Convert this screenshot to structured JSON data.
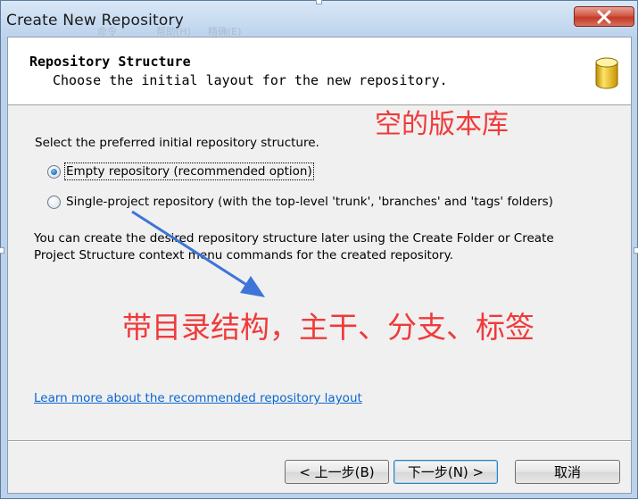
{
  "window": {
    "title": "Create New Repository",
    "background_text": [
      "命令",
      "帮助(H)",
      "精确(E)"
    ],
    "close_icon": "close-icon"
  },
  "header": {
    "title": "Repository Structure",
    "subtitle": "Choose the initial layout for the new repository.",
    "icon": "database-icon"
  },
  "annotations": {
    "empty_note": "空的版本库",
    "structure_note": "带目录结构，主干、分支、标签",
    "color": "#f03a3a"
  },
  "content": {
    "prompt": "Select the preferred initial repository structure.",
    "options": [
      {
        "label": "Empty repository (recommended option)",
        "selected": true
      },
      {
        "label": "Single-project repository (with the top-level 'trunk', 'branches' and 'tags' folders)",
        "selected": false
      }
    ],
    "info_line1": "You can create the desired repository structure later using the Create Folder or Create",
    "info_line2": "Project Structure context menu commands for the created repository.",
    "link": "Learn more about the recommended repository layout"
  },
  "buttons": {
    "back": "< 上一步(B)",
    "next": "下一步(N) >",
    "cancel": "取消"
  }
}
